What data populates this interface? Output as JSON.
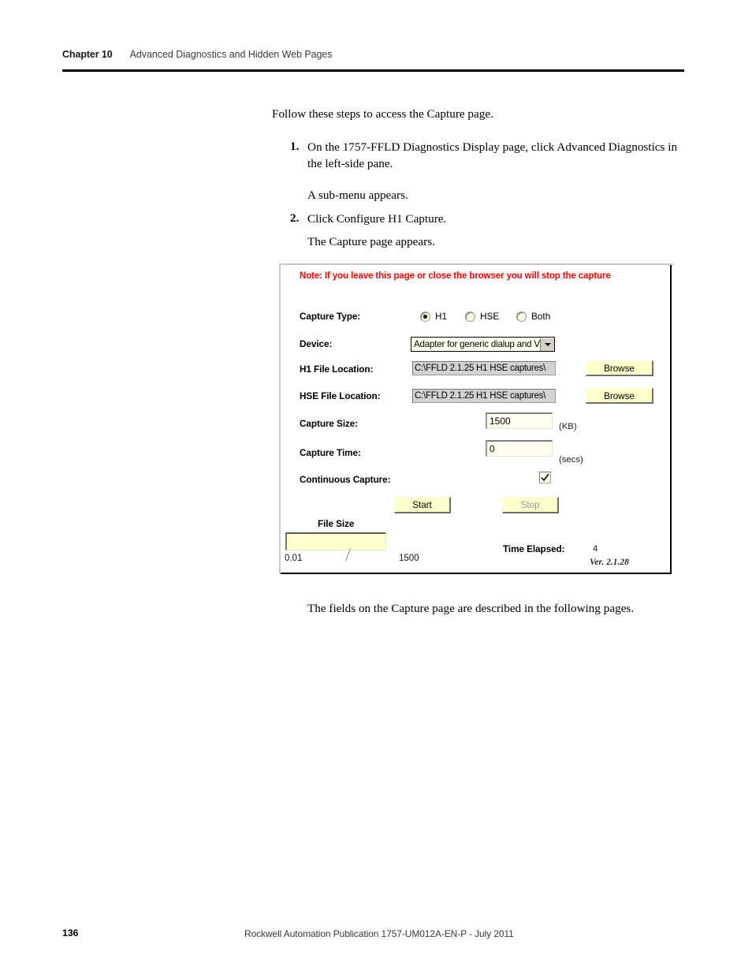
{
  "header": {
    "chapter": "Chapter 10",
    "title": "Advanced Diagnostics and Hidden Web Pages"
  },
  "body": {
    "intro": "Follow these steps to access the Capture page.",
    "steps": [
      {
        "num": "1.",
        "text": "On the 1757-FFLD Diagnostics Display page, click Advanced Diagnostics in the left-side pane.",
        "after": "A sub-menu appears."
      },
      {
        "num": "2.",
        "text": "Click Configure H1 Capture.",
        "after": "The Capture page appears."
      }
    ],
    "closing": "The fields on the Capture page are described in the following pages."
  },
  "capture_page": {
    "note": "Note: If you leave this page or close the browser you will stop the capture",
    "labels": {
      "capture_type": "Capture Type:",
      "device": "Device:",
      "h1_file_location": "H1 File Location:",
      "hse_file_location": "HSE File Location:",
      "capture_size": "Capture Size:",
      "capture_time": "Capture Time:",
      "continuous_capture": "Continuous Capture:",
      "file_size": "File Size",
      "time_elapsed": "Time Elapsed:"
    },
    "capture_type_options": [
      {
        "label": "H1",
        "selected": true
      },
      {
        "label": "HSE",
        "selected": false
      },
      {
        "label": "Both",
        "selected": false
      }
    ],
    "device": {
      "value": "Adapter for generic dialup and V"
    },
    "h1_file_location": {
      "value": "C:\\FFLD 2.1.25 H1 HSE captures\\",
      "browse_label": "Browse"
    },
    "hse_file_location": {
      "value": "C:\\FFLD 2.1.25 H1 HSE captures\\",
      "browse_label": "Browse"
    },
    "capture_size": {
      "value": "1500",
      "unit": "(KB)"
    },
    "capture_time": {
      "value": "0",
      "unit": "(secs)"
    },
    "continuous_capture": {
      "checked": true
    },
    "buttons": {
      "start": "Start",
      "stop": "Stop"
    },
    "progress": {
      "value": "",
      "min_label": "0.01",
      "max_label": "1500"
    },
    "time_elapsed_value": "4",
    "version": "Ver. 2.1.28",
    "colors": {
      "note_red": "#ff0000",
      "button_yellow": "#ffffcc",
      "field_gray": "#d2d2d2"
    }
  },
  "footer": {
    "page_number": "136",
    "publication": "Rockwell Automation Publication 1757-UM012A-EN-P - July 2011"
  }
}
